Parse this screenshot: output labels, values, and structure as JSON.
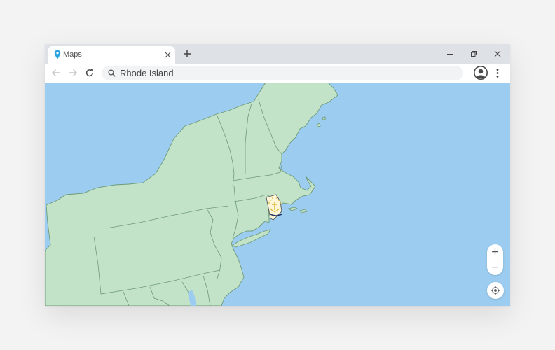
{
  "tab": {
    "title": "Maps",
    "icon": "map-pin-icon"
  },
  "omnibox": {
    "query": "Rhode Island"
  },
  "map": {
    "highlighted_region": "Rhode Island",
    "zoom_in_label": "+",
    "zoom_out_label": "−"
  },
  "colors": {
    "water": "#9ccdf0",
    "land": "#c3e3c9",
    "border": "#6e9a78",
    "pin": "#2aa3e0",
    "flag_gold": "#e0b534"
  }
}
